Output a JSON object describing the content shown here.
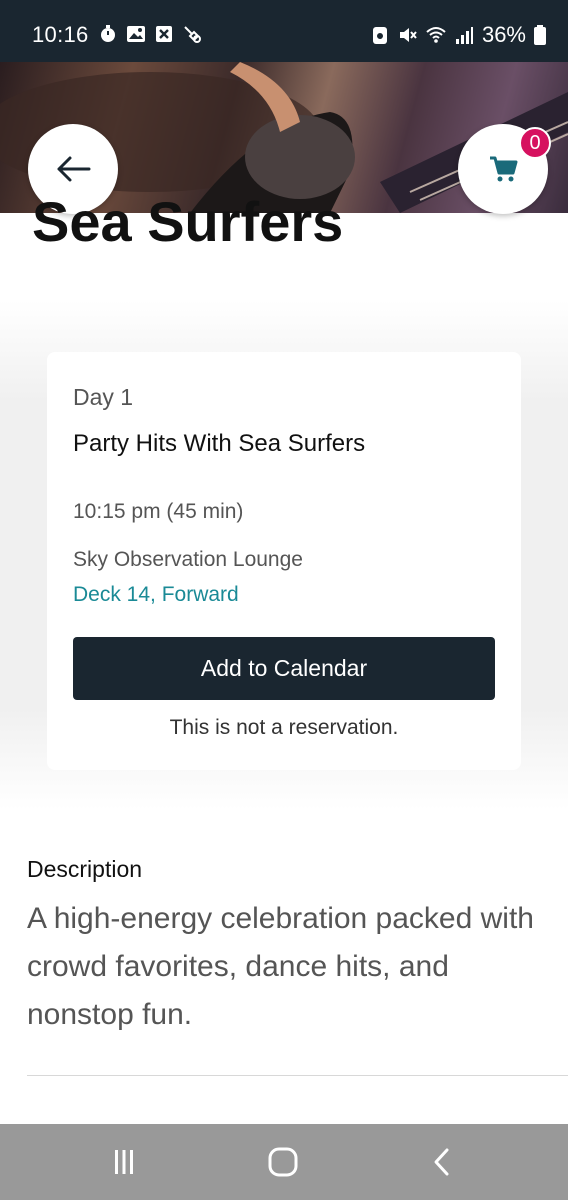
{
  "status_bar": {
    "time": "10:16",
    "battery": "36%",
    "icons": [
      "timer-icon",
      "gallery-icon",
      "blocked-notification-icon",
      "tool-icon",
      "data-saver-icon",
      "mute-icon",
      "wifi-icon",
      "signal-icon",
      "battery-icon"
    ]
  },
  "header": {
    "back_icon": "arrow-left-icon",
    "cart_icon": "cart-icon",
    "cart_count": "0"
  },
  "page": {
    "title": "Sea Surfers"
  },
  "event_card": {
    "day": "Day 1",
    "event_name": "Party Hits With Sea Surfers",
    "time": "10:15 pm (45 min)",
    "venue": "Sky Observation Lounge",
    "deck": "Deck 14, Forward",
    "calendar_button": "Add to Calendar",
    "note": "This is not a reservation."
  },
  "description": {
    "heading": "Description",
    "text": "A high-energy celebration packed with crowd favorites, dance hits, and nonstop fun."
  },
  "nav_bar": {
    "icons": [
      "recents-icon",
      "home-icon",
      "back-icon"
    ]
  },
  "colors": {
    "accent": "#1a8a96",
    "dark": "#1a2630",
    "badge": "#d6115f"
  }
}
